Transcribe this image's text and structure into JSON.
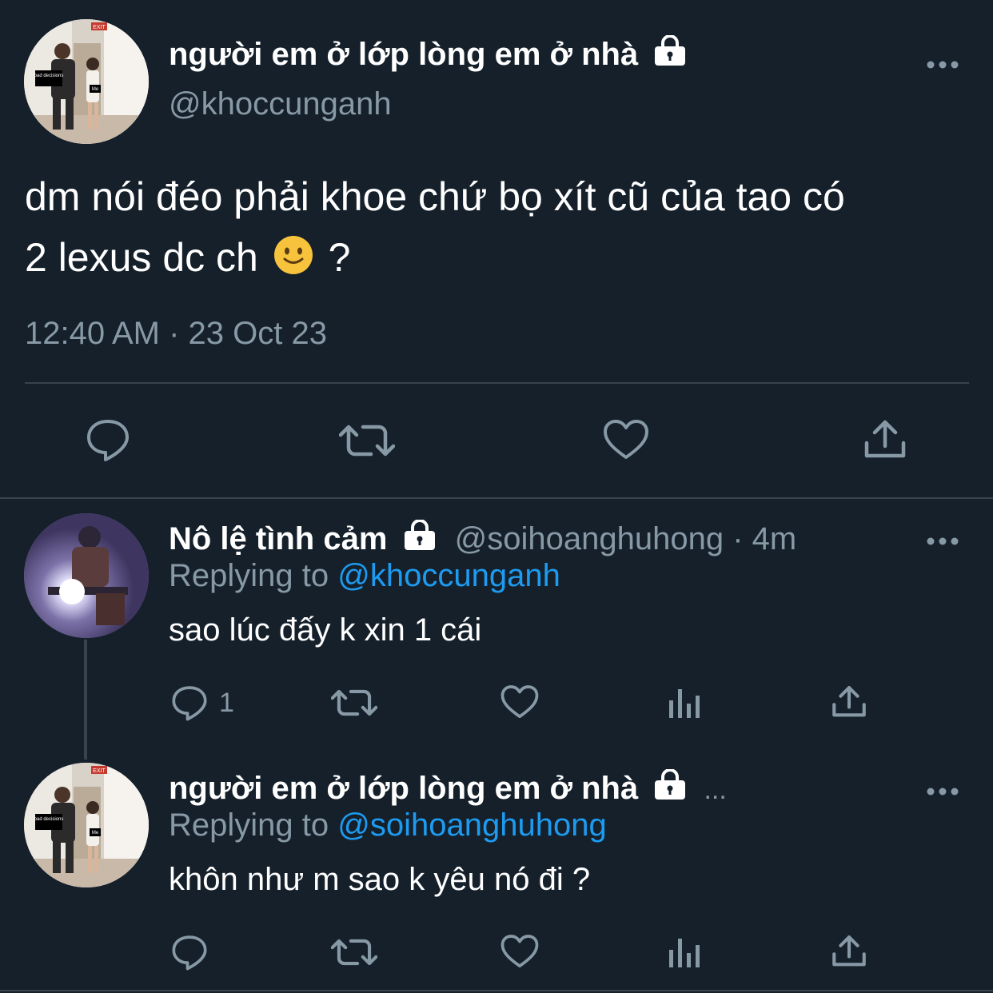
{
  "main_tweet": {
    "display_name": "người em ở lớp lòng em ở nhà",
    "handle": "@khoccunganh",
    "text_line1": "dm nói đéo phải khoe chứ bọ xít cũ của tao có",
    "text_line2_before": "2 lexus dc ch",
    "text_line2_after": "?",
    "emoji": "🙂",
    "timestamp": "12:40 AM · 23 Oct 23",
    "avatar_caption_top": "bad decisions",
    "avatar_caption_bottom": "Me",
    "avatar_exit_sign": "EXIT"
  },
  "reply1": {
    "display_name": "Nô lệ tình cảm",
    "handle": "@soihoanghuhong",
    "time": "· 4m",
    "replying_label": "Replying to",
    "replying_to": "@khoccunganh",
    "text": "sao lúc đấy k xin 1 cái",
    "reply_count": "1"
  },
  "reply2": {
    "display_name": "người em ở lớp lòng em ở nhà",
    "ellipsis": "...",
    "replying_label": "Replying to",
    "replying_to": "@soihoanghuhong",
    "text": "khôn như m sao k yêu nó đi ?",
    "avatar_caption_top": "bad decisions",
    "avatar_caption_bottom": "Me",
    "avatar_exit_sign": "EXIT"
  },
  "colors": {
    "background": "#15202b",
    "muted_text": "#8899a6",
    "link": "#1d9bf0",
    "divider": "#38444d"
  },
  "icons": [
    "more-icon",
    "lock-icon",
    "reply-icon",
    "retweet-icon",
    "like-icon",
    "share-icon",
    "analytics-icon"
  ]
}
